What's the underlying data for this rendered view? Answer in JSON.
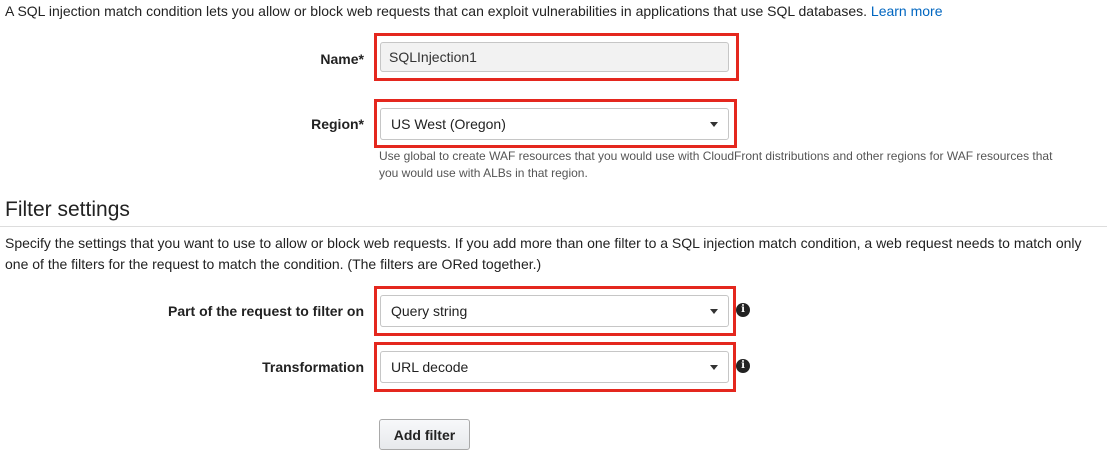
{
  "intro": {
    "text": "A SQL injection match condition lets you allow or block web requests that can exploit vulnerabilities in applications that use SQL databases.",
    "link": "Learn more"
  },
  "name_field": {
    "label": "Name*",
    "value": "SQLInjection1"
  },
  "region_field": {
    "label": "Region*",
    "selected": "US West (Oregon)",
    "help_line1": "Use global to create WAF resources that you would use with CloudFront distributions and other regions for WAF resources that",
    "help_line2": "you would use with ALBs in that region."
  },
  "filter_settings": {
    "title": "Filter settings",
    "description": "Specify the settings that you want to use to allow or block web requests. If you add more than one filter to a SQL injection match condition, a web request needs to match only one of the filters for the request to match the condition. (The filters are ORed together.)",
    "part_label": "Part of the request to filter on",
    "part_selected": "Query string",
    "transformation_label": "Transformation",
    "transformation_selected": "URL decode",
    "info_icon_glyph": "i",
    "add_filter_label": "Add filter"
  },
  "colors": {
    "highlight": "#e4271e",
    "link": "#0066c0"
  }
}
